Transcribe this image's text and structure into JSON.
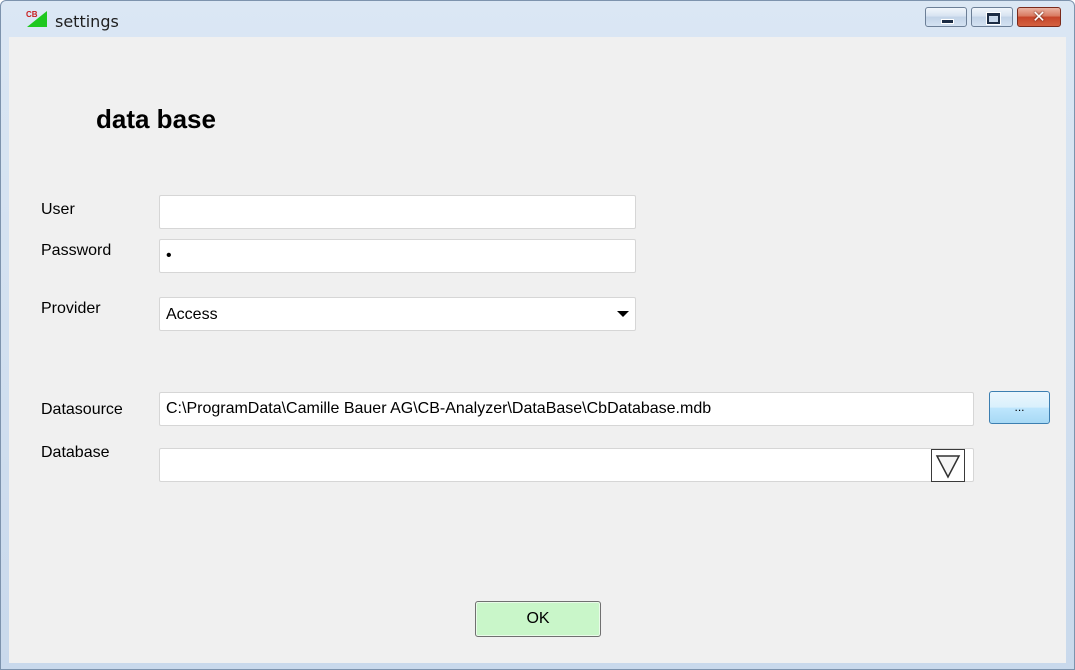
{
  "window": {
    "title": "settings",
    "icon": "cb-app-icon",
    "caption_buttons": [
      "minimize-icon",
      "restore-icon",
      "close-icon"
    ],
    "close_glyph": "✕"
  },
  "form": {
    "heading": "data base",
    "user_label": "User",
    "user_value": "",
    "password_label": "Password",
    "password_value": "•",
    "provider_label": "Provider",
    "provider_value": "Access",
    "datasource_label": "Datasource",
    "datasource_value": "C:\\ProgramData\\Camille Bauer AG\\CB-Analyzer\\DataBase\\CbDatabase.mdb",
    "browse_label": "...",
    "database_label": "Database",
    "database_value": "",
    "ok_label": "OK"
  },
  "colors": {
    "client_background": "#f0f0f0",
    "ok_button": "#c9f6c9",
    "browse_button_border": "#3c7fb1",
    "close_button": "#c6452a"
  }
}
